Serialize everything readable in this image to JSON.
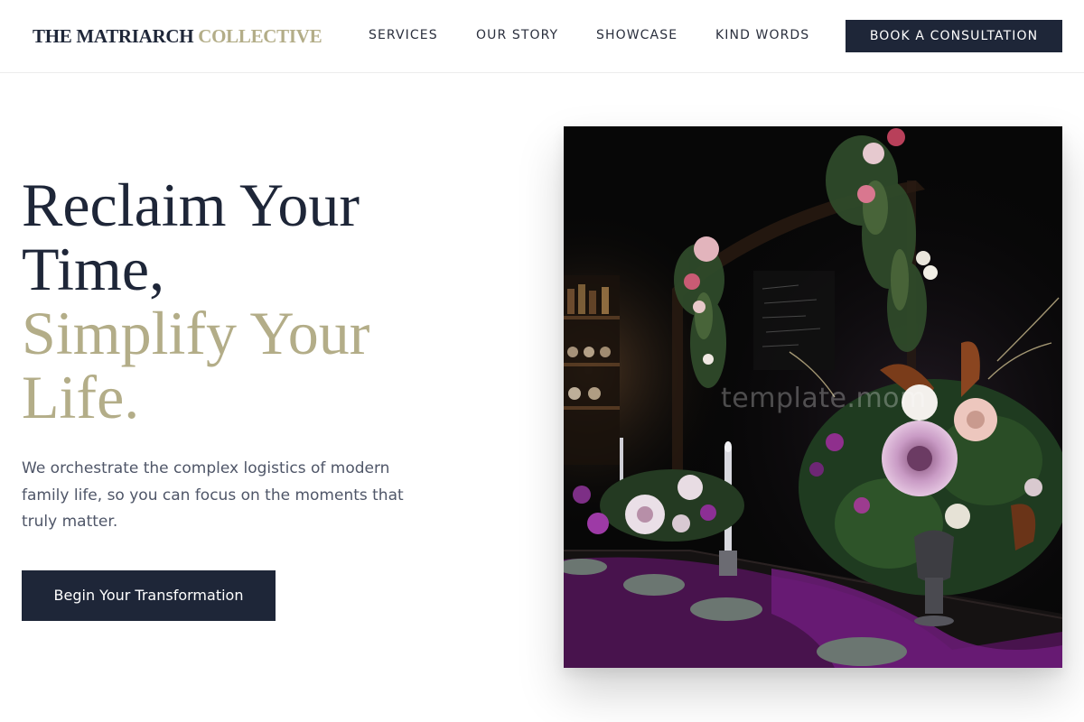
{
  "brand": {
    "name_primary": "THE MATRIARCH",
    "name_accent": "COLLECTIVE"
  },
  "nav": {
    "items": [
      {
        "label": "SERVICES"
      },
      {
        "label": "OUR STORY"
      },
      {
        "label": "SHOWCASE"
      },
      {
        "label": "KIND WORDS"
      }
    ],
    "cta_label": "BOOK A CONSULTATION"
  },
  "hero": {
    "headline_line1": "Reclaim Your Time,",
    "headline_line2": "Simplify Your Life.",
    "lede": "We orchestrate the complex logistics of modern family life, so you can focus on the moments that truly matter.",
    "cta_label": "Begin Your Transformation"
  },
  "image": {
    "watermark": "template.mom"
  },
  "colors": {
    "navy": "#1e2638",
    "sage_gold": "#b3ad88",
    "body_text": "#4f5668"
  }
}
